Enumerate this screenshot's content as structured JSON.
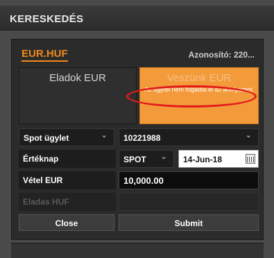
{
  "window": {
    "title": "KERESKEDÉS"
  },
  "ticket": {
    "pair": "EUR.HUF",
    "identifier": "Azonosító: 220...",
    "sell_label": "Eladok EUR",
    "buy_label": "Veszünk EUR",
    "buy_error": "Az ügyfél nem fogadta el az árfolyamot."
  },
  "form": {
    "deal_type": "Spot ügylet",
    "account": "10221988",
    "value_date_label": "Értéknap",
    "value_date_type": "SPOT",
    "value_date": "14-Jun-18",
    "buy_amount_label": "Vétel EUR",
    "buy_amount": "10,000.00",
    "sell_amount_label": "Eladas HUF",
    "sell_amount": "",
    "close_label": "Close",
    "submit_label": "Submit"
  },
  "colors": {
    "accent": "#f08a1c",
    "buy_button": "#f39a3a",
    "annotation": "#e21a1a"
  },
  "icons": [
    "chevron-down-icon",
    "calendar-icon"
  ]
}
